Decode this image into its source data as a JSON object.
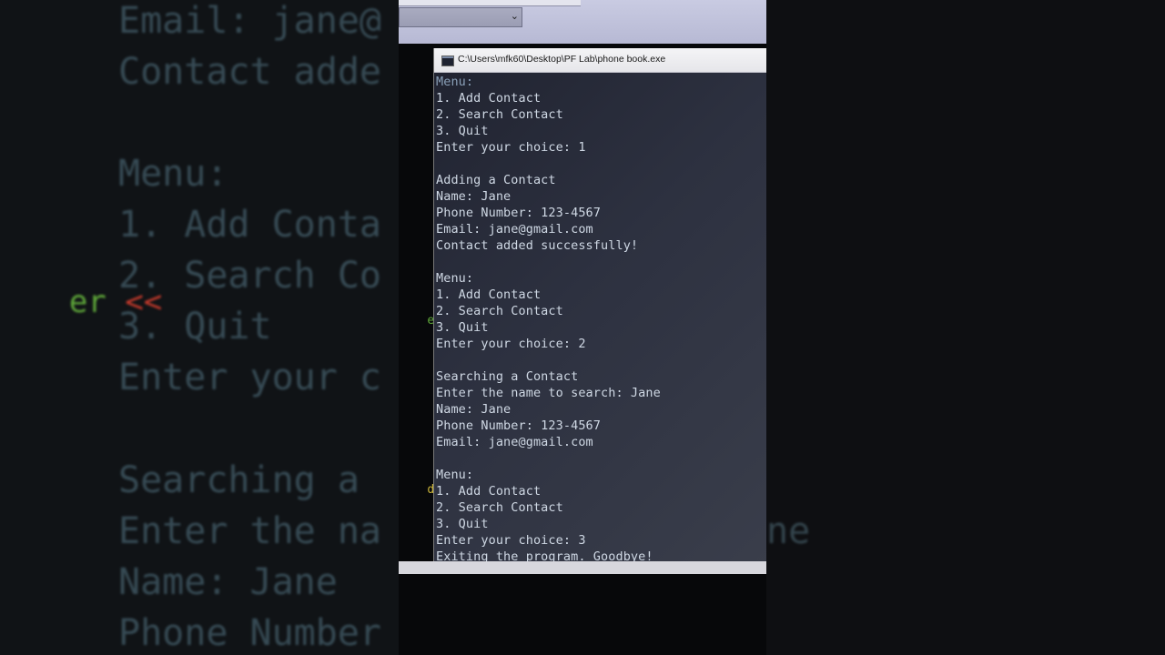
{
  "window": {
    "title": "C:\\Users\\mfk60\\Desktop\\PF Lab\\phone book.exe"
  },
  "console_lines": [
    "Menu:",
    "1. Add Contact",
    "2. Search Contact",
    "3. Quit",
    "Enter your choice: 1",
    "",
    "Adding a Contact",
    "Name: Jane",
    "Phone Number: 123-4567",
    "Email: jane@gmail.com",
    "Contact added successfully!",
    "",
    "Menu:",
    "1. Add Contact",
    "2. Search Contact",
    "3. Quit",
    "Enter your choice: 2",
    "",
    "Searching a Contact",
    "Enter the name to search: Jane",
    "Name: Jane",
    "Phone Number: 123-4567",
    "Email: jane@gmail.com",
    "",
    "Menu:",
    "1. Add Contact",
    "2. Search Contact",
    "3. Quit",
    "Enter your choice: 3",
    "Exiting the program. Goodbye!"
  ],
  "background_left": {
    "lines": [
      "Email: jane@",
      "Contact adde",
      "",
      "Menu:",
      "1. Add Conta",
      "2. Search Co",
      "3. Quit",
      "Enter your c",
      "",
      "Searching a",
      "Enter the na",
      "Name: Jane",
      "Phone Number"
    ],
    "code_fragment": "er <<"
  },
  "background_right": {
    "fragment": "ne"
  },
  "side_code": {
    "fragment_1": "er <<",
    "fragment_2": "dl;"
  },
  "colors": {
    "console_text": "#cfd8e4",
    "code_red": "#c0392b",
    "code_green": "#5fa83a",
    "code_yellow": "#c9b43a"
  }
}
